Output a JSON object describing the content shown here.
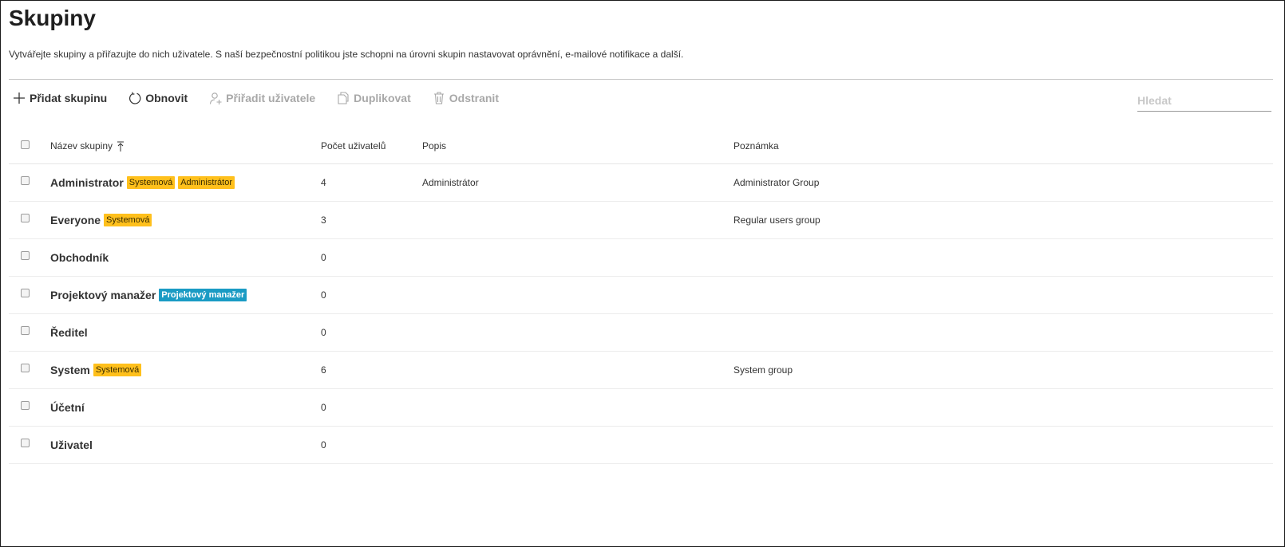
{
  "page": {
    "title": "Skupiny",
    "description": "Vytvářejte skupiny a přiřazujte do nich uživatele. S naší bezpečnostní politikou jste schopni na úrovni skupin nastavovat oprávnění, e-mailové notifikace a další."
  },
  "toolbar": {
    "add_group": "Přidat skupinu",
    "refresh": "Obnovit",
    "assign_users": "Přiřadit uživatele",
    "duplicate": "Duplikovat",
    "delete": "Odstranit"
  },
  "search": {
    "placeholder": "Hledat"
  },
  "table": {
    "headers": {
      "name": "Název skupiny",
      "count": "Počet uživatelů",
      "description": "Popis",
      "note": "Poznámka"
    },
    "rows": [
      {
        "name": "Administrator",
        "badges": [
          {
            "text": "Systemová",
            "kind": "sys"
          },
          {
            "text": "Administrátor",
            "kind": "sys"
          }
        ],
        "count": "4",
        "description": "Administrátor",
        "note": "Administrator Group"
      },
      {
        "name": "Everyone",
        "badges": [
          {
            "text": "Systemová",
            "kind": "sys"
          }
        ],
        "count": "3",
        "description": "",
        "note": "Regular users group"
      },
      {
        "name": "Obchodník",
        "badges": [],
        "count": "0",
        "description": "",
        "note": ""
      },
      {
        "name": "Projektový manažer",
        "badges": [
          {
            "text": "Projektový manažer",
            "kind": "pm"
          }
        ],
        "count": "0",
        "description": "",
        "note": ""
      },
      {
        "name": "Ředitel",
        "badges": [],
        "count": "0",
        "description": "",
        "note": ""
      },
      {
        "name": "System",
        "badges": [
          {
            "text": "Systemová",
            "kind": "sys"
          }
        ],
        "count": "6",
        "description": "",
        "note": "System group"
      },
      {
        "name": "Účetní",
        "badges": [],
        "count": "0",
        "description": "",
        "note": ""
      },
      {
        "name": "Uživatel",
        "badges": [],
        "count": "0",
        "description": "",
        "note": ""
      }
    ]
  },
  "colors": {
    "system_badge": "#ffc01c",
    "role_badge": "#1a9bc4",
    "disabled_text": "#a8a8a8"
  },
  "icons": {
    "add": "plus-icon",
    "refresh": "refresh-icon",
    "assign": "add-user-icon",
    "duplicate": "copy-icon",
    "delete": "trash-icon",
    "sort": "sort-ascending-icon"
  }
}
